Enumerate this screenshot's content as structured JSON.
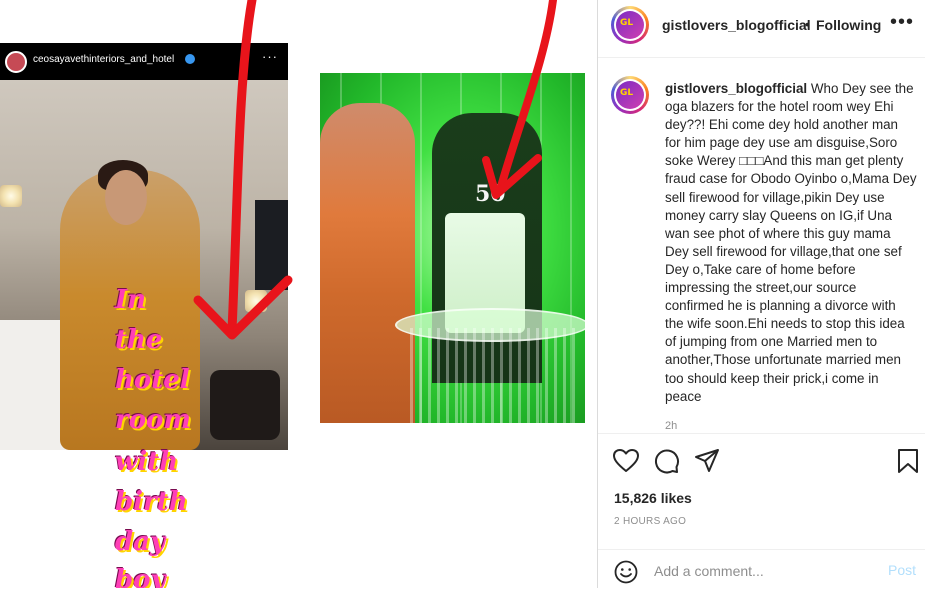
{
  "post": {
    "username": "gistlovers_blogofficial",
    "follow_separator": "•",
    "follow_status": "Following",
    "more_icon": "more-horizontal-icon",
    "avatar_text": "GL",
    "caption": "Who Dey see the oga blazers for the hotel room wey Ehi dey??! Ehi come dey hold another man for him page dey use am disguise,Soro soke Werey □□□And this man get plenty fraud case for Obodo Oyinbo o,Mama Dey sell firewood for village,pikin Dey use money carry slay Queens on IG,if Una wan see phot of where this guy mama Dey sell firewood for village,that one sef Dey o,Take care of home before impressing the street,our source confirmed he is planning a divorce with the wife soon.Ehi needs to stop this idea of jumping from one Married men to another,Those unfortunate married men too should keep their prick,i come in peace",
    "caption_age": "2h",
    "likes": "15,826 likes",
    "posted_time": "2 HOURS AGO",
    "comment_placeholder": "Add a comment...",
    "post_label": "Post"
  },
  "media": {
    "screenshot": {
      "username": "ceosayavethinteriors_and_hotel",
      "more": "···",
      "overlay_lines": [
        "In",
        "the",
        "hotel",
        "room",
        "with",
        "birth",
        "day",
        "boy"
      ]
    },
    "cake_number": "50"
  },
  "colors": {
    "annotation_red": "#e8141b",
    "overlay_pink": "#ff3fb7",
    "overlay_yellow": "#ffd400",
    "post_button": "#b2dffc",
    "muted_text": "#8e8e8e"
  },
  "icons": [
    "heart-icon",
    "comment-icon",
    "share-icon",
    "bookmark-icon",
    "emoji-icon",
    "verified-badge-icon",
    "more-horizontal-icon"
  ]
}
